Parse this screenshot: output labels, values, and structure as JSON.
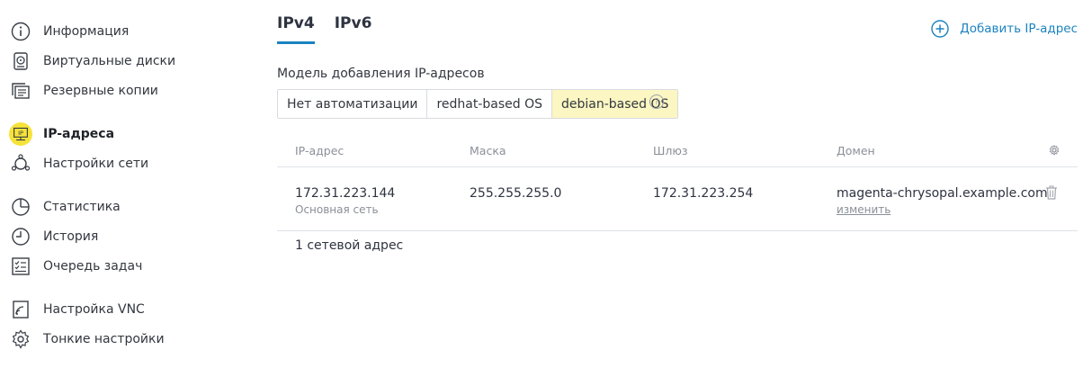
{
  "sidebar": {
    "items": [
      {
        "label": "Информация",
        "icon": "info-icon"
      },
      {
        "label": "Виртуальные диски",
        "icon": "disk-icon"
      },
      {
        "label": "Резервные копии",
        "icon": "backup-icon"
      },
      {
        "label": "IP-адреса",
        "icon": "ip-icon",
        "active": true
      },
      {
        "label": "Настройки сети",
        "icon": "network-icon"
      },
      {
        "label": "Статистика",
        "icon": "stats-icon"
      },
      {
        "label": "История",
        "icon": "history-icon"
      },
      {
        "label": "Очередь задач",
        "icon": "task-queue-icon"
      },
      {
        "label": "Настройка VNC",
        "icon": "vnc-icon"
      },
      {
        "label": "Тонкие настройки",
        "icon": "fine-tune-icon"
      }
    ]
  },
  "tabs": [
    {
      "label": "IPv4",
      "active": true
    },
    {
      "label": "IPv6",
      "active": false
    }
  ],
  "add_ip_label": "Добавить IP-адрес",
  "model": {
    "label": "Модель добавления IP-адресов",
    "options": [
      "Нет автоматизации",
      "redhat-based OS",
      "debian-based OS"
    ],
    "selected": "debian-based OS",
    "help": "?"
  },
  "table": {
    "columns": [
      "IP-адрес",
      "Маска",
      "Шлюз",
      "Домен"
    ],
    "rows": [
      {
        "ip": "172.31.223.144",
        "network": "Основная сеть",
        "mask": "255.255.255.0",
        "gateway": "172.31.223.254",
        "domain": "magenta-chrysopal.example.com",
        "change_label": "изменить"
      }
    ],
    "footer": "1 сетевой адрес"
  },
  "colors": {
    "accent": "#1b83c0",
    "active_badge": "#f6e33a",
    "selected_option": "#fbf6c2"
  }
}
